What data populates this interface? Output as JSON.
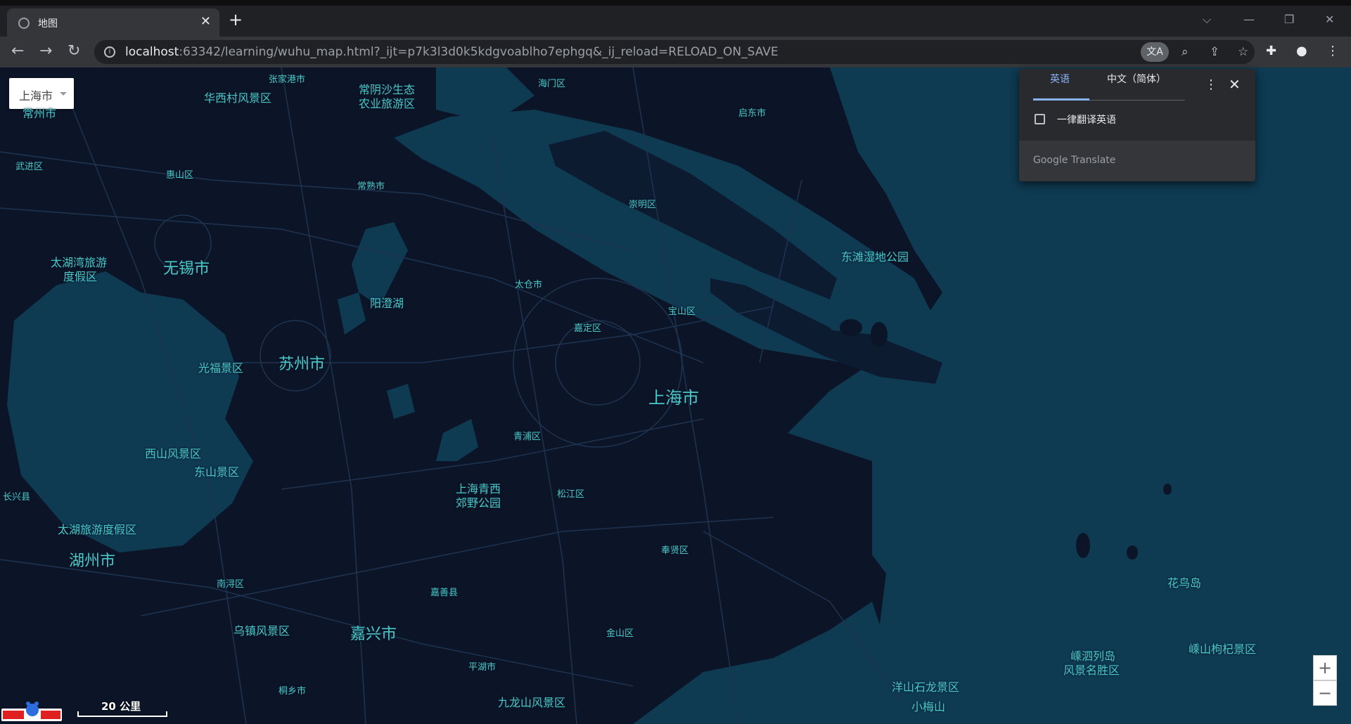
{
  "browser": {
    "tab_title": "地图",
    "tab_close": "✕",
    "new_tab": "+",
    "url_host": "localhost",
    "url_rest": ":63342/learning/wuhu_map.html?_ijt=p7k3l3d0k5kdgvoablho7ephgq&_ij_reload=RELOAD_ON_SAVE",
    "window_controls": [
      "⌵",
      "—",
      "❐",
      "✕"
    ]
  },
  "map": {
    "city_select_value": "上海市",
    "scale_label": "20 公里",
    "zoom_in": "+",
    "zoom_out": "−",
    "labels": [
      {
        "text": "常州市",
        "size": "md"
      },
      {
        "text": "张家港市",
        "size": "sm"
      },
      {
        "text": "华西村风景区",
        "size": "md"
      },
      {
        "text": "常阴沙生态",
        "size": "md"
      },
      {
        "text": "农业旅游区",
        "size": "md"
      },
      {
        "text": "海门区",
        "size": "sm"
      },
      {
        "text": "启东市",
        "size": "sm"
      },
      {
        "text": "武进区",
        "size": "sm"
      },
      {
        "text": "惠山区",
        "size": "sm"
      },
      {
        "text": "常熟市",
        "size": "sm"
      },
      {
        "text": "崇明区",
        "size": "sm"
      },
      {
        "text": "太湖湾旅游",
        "size": "md"
      },
      {
        "text": "度假区",
        "size": "md"
      },
      {
        "text": "无锡市",
        "size": "lg"
      },
      {
        "text": "东滩湿地公园",
        "size": "md"
      },
      {
        "text": "阳澄湖",
        "size": "md"
      },
      {
        "text": "太仓市",
        "size": "sm"
      },
      {
        "text": "宝山区",
        "size": "sm"
      },
      {
        "text": "嘉定区",
        "size": "sm"
      },
      {
        "text": "光福景区",
        "size": "md"
      },
      {
        "text": "苏州市",
        "size": "lg"
      },
      {
        "text": "上海市",
        "size": "xl"
      },
      {
        "text": "青浦区",
        "size": "sm"
      },
      {
        "text": "西山风景区",
        "size": "md"
      },
      {
        "text": "东山景区",
        "size": "md"
      },
      {
        "text": "上海青西",
        "size": "md"
      },
      {
        "text": "郊野公园",
        "size": "md"
      },
      {
        "text": "松江区",
        "size": "sm"
      },
      {
        "text": "长兴县",
        "size": "sm"
      },
      {
        "text": "太湖旅游度假区",
        "size": "md"
      },
      {
        "text": "湖州市",
        "size": "lg"
      },
      {
        "text": "奉贤区",
        "size": "sm"
      },
      {
        "text": "花鸟岛",
        "size": "md"
      },
      {
        "text": "南浔区",
        "size": "sm"
      },
      {
        "text": "嘉善县",
        "size": "sm"
      },
      {
        "text": "乌镇风景区",
        "size": "md"
      },
      {
        "text": "嘉兴市",
        "size": "lg"
      },
      {
        "text": "金山区",
        "size": "sm"
      },
      {
        "text": "嵊泗列岛",
        "size": "md"
      },
      {
        "text": "风景名胜区",
        "size": "md"
      },
      {
        "text": "嵊山枸杞景区",
        "size": "md"
      },
      {
        "text": "平湖市",
        "size": "sm"
      },
      {
        "text": "洋山石龙景区",
        "size": "md"
      },
      {
        "text": "桐乡市",
        "size": "sm"
      },
      {
        "text": "九龙山风景区",
        "size": "md"
      },
      {
        "text": "小梅山",
        "size": "md"
      }
    ]
  },
  "translate_popup": {
    "tab_source": "英语",
    "tab_target": "中文（简体）",
    "always_translate": "一律翻译英语",
    "footer": "Google Translate",
    "menu": "⋮",
    "close": "✕"
  },
  "colors": {
    "map_bg": "#0b1527",
    "water": "#0e3a52",
    "road": "#1f3350",
    "label": "#49c8c8"
  }
}
